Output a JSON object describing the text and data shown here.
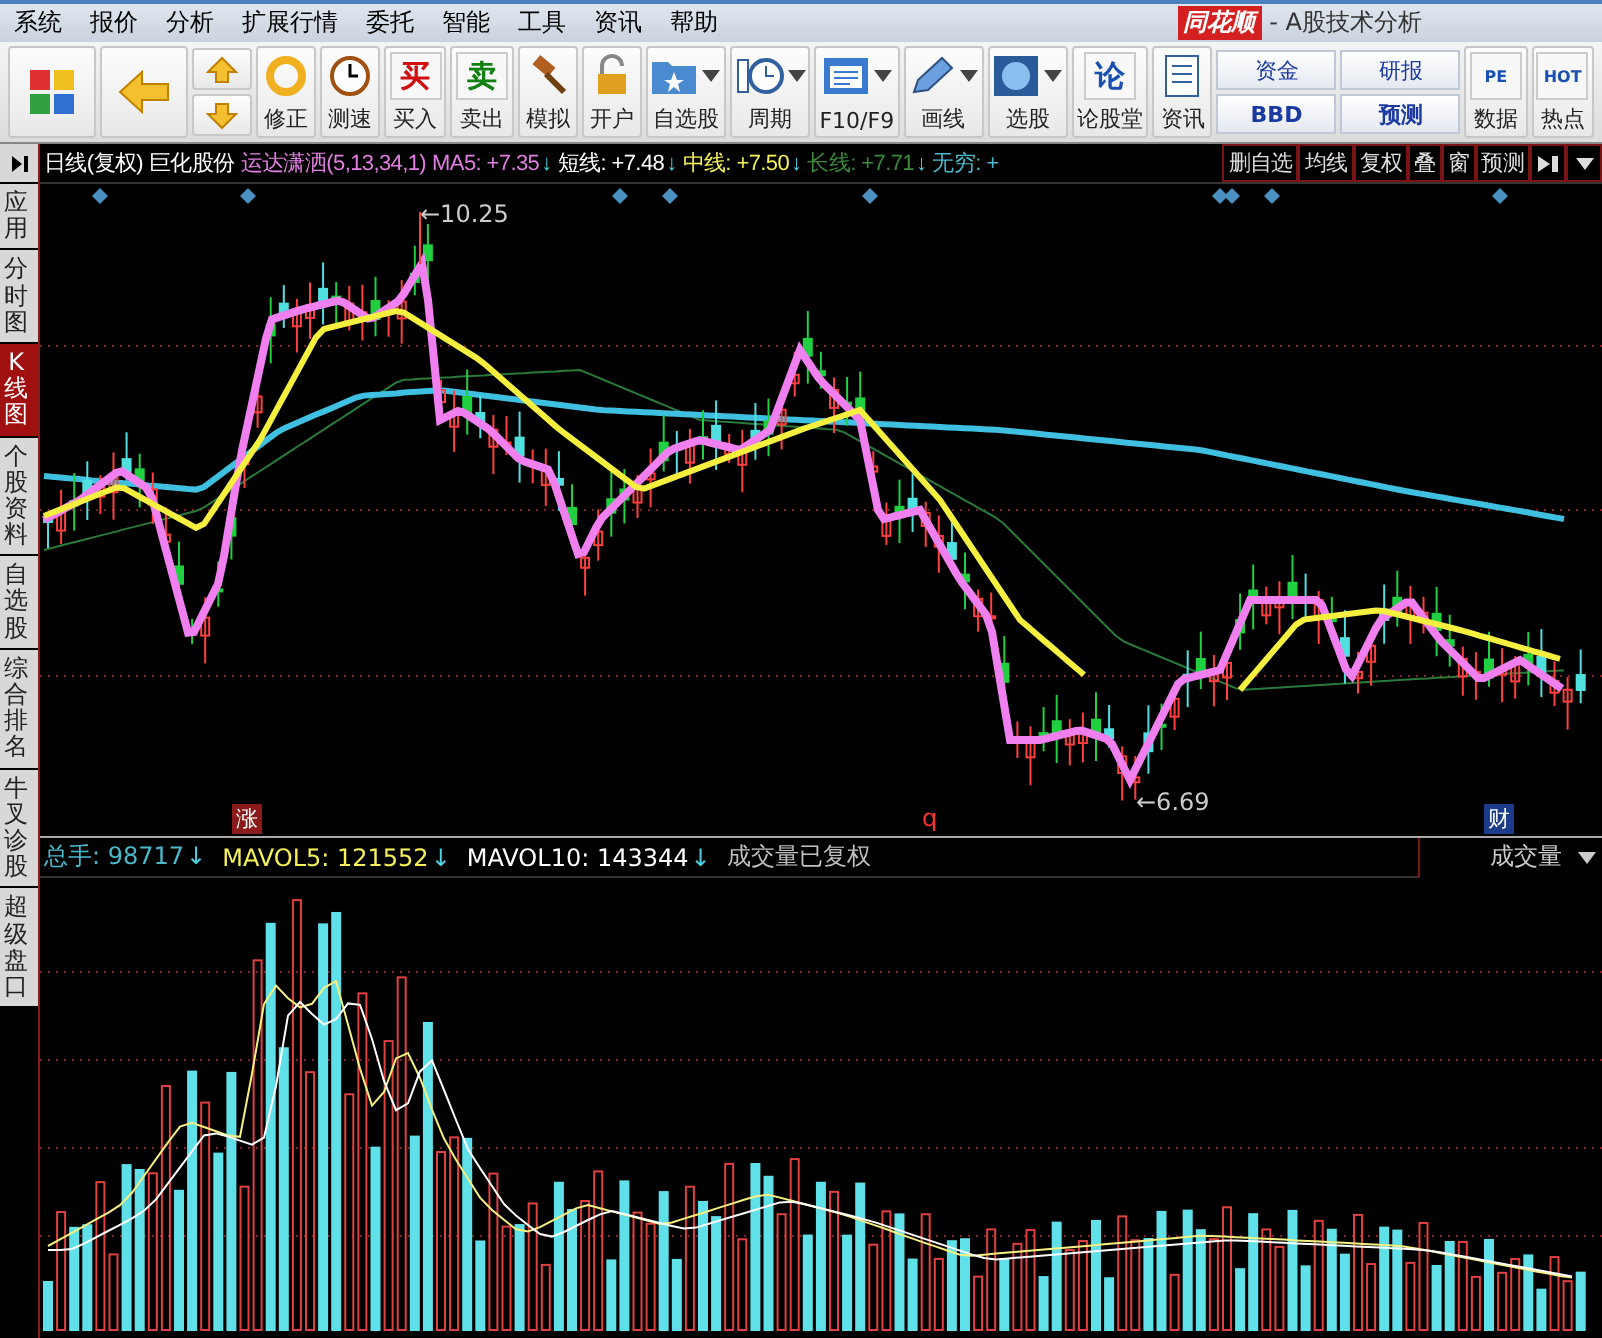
{
  "menu": [
    "系统",
    "报价",
    "分析",
    "扩展行情",
    "委托",
    "智能",
    "工具",
    "资讯",
    "帮助"
  ],
  "window": {
    "logo": "同花顺",
    "title": "- A股技术分析"
  },
  "toolbar": [
    {
      "kind": "icon"
    },
    {
      "kind": "icon"
    },
    {
      "kind": "stack"
    },
    {
      "kind": "labeled",
      "label": "修正",
      "dropdown": false
    },
    {
      "kind": "labeled",
      "label": "测速",
      "dropdown": false
    },
    {
      "kind": "labeled",
      "label": "买入",
      "glyph": "买",
      "dropdown": false
    },
    {
      "kind": "labeled",
      "label": "卖出",
      "glyph": "卖",
      "dropdown": false
    },
    {
      "kind": "labeled",
      "label": "模拟",
      "dropdown": false
    },
    {
      "kind": "labeled",
      "label": "开户",
      "dropdown": false
    },
    {
      "kind": "labeled",
      "label": "自选股",
      "dropdown": true
    },
    {
      "kind": "labeled",
      "label": "周期",
      "dropdown": true
    },
    {
      "kind": "labeled",
      "label": "F10/F9",
      "dropdown": true
    },
    {
      "kind": "labeled",
      "label": "画线",
      "dropdown": true
    },
    {
      "kind": "labeled",
      "label": "选股",
      "dropdown": true
    },
    {
      "kind": "labeled",
      "label": "论股堂",
      "glyph": "论",
      "dropdown": false
    },
    {
      "kind": "labeled",
      "label": "资讯",
      "dropdown": false
    },
    {
      "kind": "pair",
      "top": "资金",
      "bottom": "BBD"
    },
    {
      "kind": "pair",
      "top": "研报",
      "bottom": "预测"
    },
    {
      "kind": "labeled",
      "label": "数据",
      "glyph": "PE",
      "dropdown": false
    },
    {
      "kind": "labeled",
      "label": "热点",
      "glyph": "HOT",
      "dropdown": false
    }
  ],
  "sidebar": [
    {
      "label": "应用",
      "selected": false
    },
    {
      "label": "分时图",
      "selected": false
    },
    {
      "label": "K线图",
      "selected": true
    },
    {
      "label": "个股资料",
      "selected": false
    },
    {
      "label": "自选股",
      "selected": false
    },
    {
      "label": "综合排名",
      "selected": false
    },
    {
      "label": "牛叉诊股",
      "selected": false
    },
    {
      "label": "超级盘口",
      "selected": false
    }
  ],
  "chart_header": {
    "items": [
      {
        "text": "日线(复权)",
        "color": "#ffffff"
      },
      {
        "text": "巨化股份",
        "color": "#ffffff"
      },
      {
        "text": "运达潇洒(5,13,34,1)",
        "color": "#e37fe3"
      },
      {
        "text": "MA5: +7.35",
        "arrow": "↓",
        "color": "#e37fe3"
      },
      {
        "text": "短线: +7.48",
        "arrow": "↓",
        "color": "#ffffff"
      },
      {
        "text": "中线: +7.50",
        "arrow": "↓",
        "color": "#f5f05a"
      },
      {
        "text": "长线: +7.71",
        "arrow": "↓",
        "color": "#3a8a3a"
      },
      {
        "text": "无穷: +",
        "color": "#4ab8c8"
      }
    ],
    "buttons": [
      "删自选",
      "均线",
      "复权",
      "叠",
      "窗",
      "预测"
    ]
  },
  "price_chart": {
    "annotations": [
      {
        "kind": "price",
        "text": "←10.25"
      },
      {
        "kind": "price",
        "text": "←6.69"
      },
      {
        "kind": "tag",
        "text": "涨",
        "color": "#8b1a1a"
      },
      {
        "kind": "mark",
        "text": "q",
        "color": "#ff3030"
      },
      {
        "kind": "tag",
        "text": "财",
        "color": "#1a3c8b"
      }
    ]
  },
  "volume_header": {
    "items": [
      {
        "text": "总手: 98717",
        "arrow": "↓",
        "color": "#4ab8c8"
      },
      {
        "text": "MAVOL5: 121552",
        "arrow": "↓",
        "color": "#f5f05a"
      },
      {
        "text": "MAVOL10: 143344",
        "arrow": "↓",
        "color": "#ffffff"
      },
      {
        "text": "成交量已复权",
        "color": "#c0c0c0"
      }
    ],
    "selector": "成交量"
  }
}
